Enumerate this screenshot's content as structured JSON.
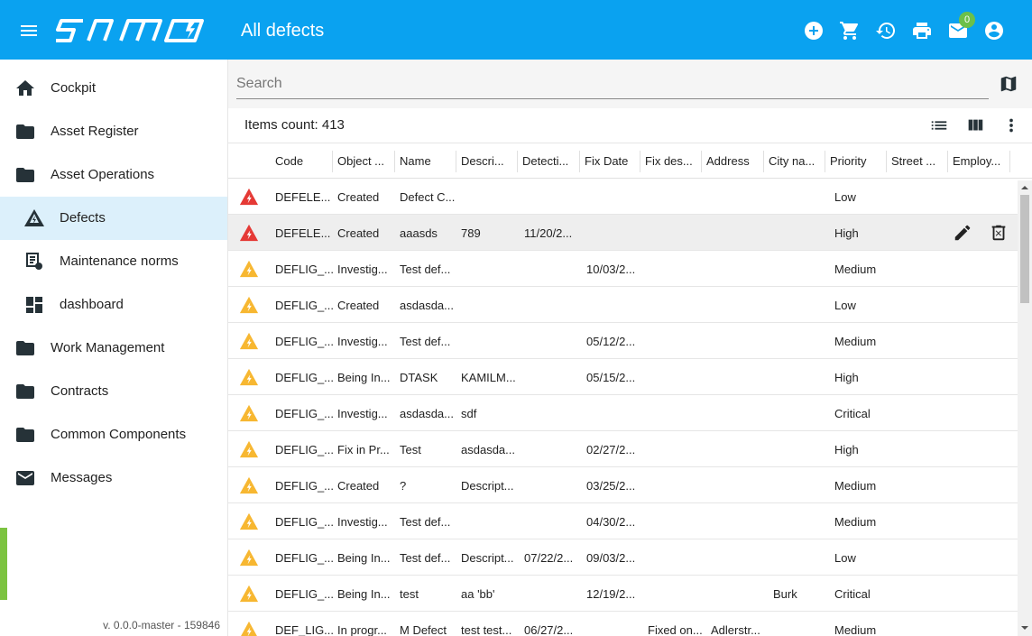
{
  "header": {
    "title": "All defects",
    "mail_badge": "0",
    "brand_color": "#0aa2f0"
  },
  "sidebar": {
    "items": [
      {
        "label": "Cockpit",
        "icon": "home-icon"
      },
      {
        "label": "Asset Register",
        "icon": "folder-icon"
      },
      {
        "label": "Asset Operations",
        "icon": "folder-icon"
      },
      {
        "label": "Defects",
        "icon": "defects-icon",
        "active": true
      },
      {
        "label": "Maintenance norms",
        "icon": "maintenance-norms-icon"
      },
      {
        "label": "dashboard",
        "icon": "dashboard-icon"
      },
      {
        "label": "Work Management",
        "icon": "folder-icon"
      },
      {
        "label": "Contracts",
        "icon": "folder-icon"
      },
      {
        "label": "Common Components",
        "icon": "folder-icon"
      },
      {
        "label": "Messages",
        "icon": "mail-icon"
      }
    ],
    "version": "v. 0.0.0-master - 159846",
    "active_color": "#dcf0fb",
    "accent_green": "#7cc341"
  },
  "main": {
    "search_placeholder": "Search",
    "items_count": "Items count: 413",
    "columns": [
      "Code",
      "Object ...",
      "Name",
      "Descri...",
      "Detecti...",
      "Fix Date",
      "Fix des...",
      "Address",
      "City na...",
      "Priority",
      "Street ...",
      "Employ..."
    ],
    "rows": [
      {
        "severity": "red",
        "cells": [
          "DEFELE...",
          "Created",
          "Defect C...",
          "",
          "",
          "",
          "",
          "",
          "",
          "Low"
        ]
      },
      {
        "severity": "red",
        "cells": [
          "DEFELE...",
          "Created",
          "aaasds",
          "789",
          "11/20/2...",
          "",
          "",
          "",
          "",
          "High"
        ],
        "hover": true
      },
      {
        "severity": "yellow",
        "cells": [
          "DEFLIG_...",
          "Investig...",
          "Test def...",
          "",
          "",
          "10/03/2...",
          "",
          "",
          "",
          "Medium"
        ]
      },
      {
        "severity": "yellow",
        "cells": [
          "DEFLIG_...",
          "Created",
          "asdasda...",
          "",
          "",
          "",
          "",
          "",
          "",
          "Low"
        ]
      },
      {
        "severity": "yellow",
        "cells": [
          "DEFLIG_...",
          "Investig...",
          "Test def...",
          "",
          "",
          "05/12/2...",
          "",
          "",
          "",
          "Medium"
        ]
      },
      {
        "severity": "yellow",
        "cells": [
          "DEFLIG_...",
          "Being In...",
          "DTASK",
          "KAMILM...",
          "",
          "05/15/2...",
          "",
          "",
          "",
          "High"
        ]
      },
      {
        "severity": "yellow",
        "cells": [
          "DEFLIG_...",
          "Investig...",
          "asdasda...",
          "sdf",
          "",
          "",
          "",
          "",
          "",
          "Critical"
        ]
      },
      {
        "severity": "yellow",
        "cells": [
          "DEFLIG_...",
          "Fix in Pr...",
          "Test",
          "asdasda...",
          "",
          "02/27/2...",
          "",
          "",
          "",
          "High"
        ]
      },
      {
        "severity": "yellow",
        "cells": [
          "DEFLIG_...",
          "Created",
          "?",
          "Descript...",
          "",
          "03/25/2...",
          "",
          "",
          "",
          "Medium"
        ]
      },
      {
        "severity": "yellow",
        "cells": [
          "DEFLIG_...",
          "Investig...",
          "Test def...",
          "",
          "",
          "04/30/2...",
          "",
          "",
          "",
          "Medium"
        ]
      },
      {
        "severity": "yellow",
        "cells": [
          "DEFLIG_...",
          "Being In...",
          "Test def...",
          "Descript...",
          "07/22/2...",
          "09/03/2...",
          "",
          "",
          "",
          "Low"
        ]
      },
      {
        "severity": "yellow",
        "cells": [
          "DEFLIG_...",
          "Being In...",
          "test",
          "aa 'bb'",
          "",
          "12/19/2...",
          "",
          "",
          "Burk",
          "Critical"
        ]
      },
      {
        "severity": "yellow",
        "cells": [
          "DEF_LIG...",
          "In progr...",
          "M Defect",
          "test test...",
          "06/27/2...",
          "",
          "Fixed on...",
          "Adlerstr...",
          "",
          "Medium"
        ]
      }
    ],
    "severity_colors": {
      "red": "#e53935",
      "yellow": "#f7b731"
    }
  }
}
